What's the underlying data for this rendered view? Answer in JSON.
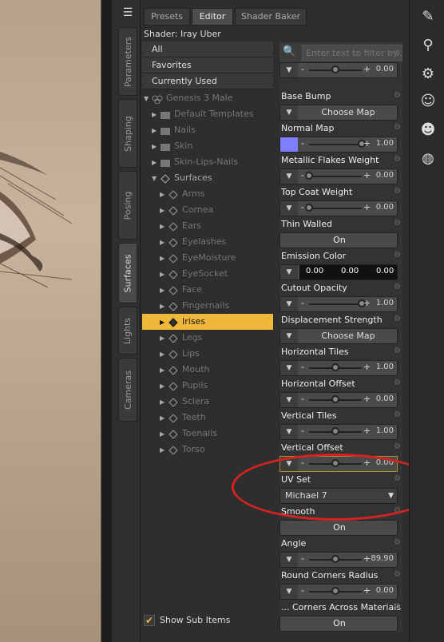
{
  "left_tabs": [
    "Parameters",
    "Shaping",
    "Posing",
    "Surfaces",
    "Lights",
    "Cameras"
  ],
  "top_tabs": [
    "Presets",
    "Editor",
    "Shader Baker"
  ],
  "shader_label": "Shader: Iray Uber",
  "categories": [
    "All",
    "Favorites",
    "Currently Used"
  ],
  "tree": {
    "root": "Genesis 3 Male",
    "folders": [
      "Default Templates",
      "Nails",
      "Skin",
      "Skin-Lips-Nails"
    ],
    "surfaces_label": "Surfaces",
    "surfaces": [
      "Arms",
      "Cornea",
      "Ears",
      "Eyelashes",
      "EyeMoisture",
      "EyeSocket",
      "Face",
      "Fingernails",
      "Irises",
      "Legs",
      "Lips",
      "Mouth",
      "Pupils",
      "Sclera",
      "Teeth",
      "Toenails",
      "Torso"
    ],
    "selected": "Irises"
  },
  "show_sub_items": "Show Sub Items",
  "filter_placeholder": "Enter text to filter by...",
  "properties": [
    {
      "label": "",
      "value": "0.00",
      "knob": 0.5
    },
    {
      "label": "Base Bump",
      "action": "Choose Map"
    },
    {
      "label": "Normal Map",
      "value": "1.00",
      "knob": 1.0,
      "swatch": "#8080ff"
    },
    {
      "label": "Metallic Flakes Weight",
      "value": "0.00",
      "knob": 0.0
    },
    {
      "label": "Top Coat Weight",
      "value": "0.00",
      "knob": 0.0
    },
    {
      "label": "Thin Walled",
      "toggle": "On"
    },
    {
      "label": "Emission Color",
      "rgb": [
        "0.00",
        "0.00",
        "0.00"
      ]
    },
    {
      "label": "Cutout Opacity",
      "value": "1.00",
      "knob": 1.0
    },
    {
      "label": "Displacement Strength",
      "action": "Choose Map"
    },
    {
      "label": "Horizontal Tiles",
      "value": "1.00",
      "knob": 0.5
    },
    {
      "label": "Horizontal Offset",
      "value": "0.00",
      "knob": 0.5
    },
    {
      "label": "Vertical Tiles",
      "value": "1.00",
      "knob": 0.5
    },
    {
      "label": "Vertical Offset",
      "value": "0.00",
      "knob": 0.5
    },
    {
      "label": "UV Set",
      "select": "Michael 7"
    },
    {
      "label": "Smooth",
      "toggle": "On"
    },
    {
      "label": "Angle",
      "value": "89.90",
      "knob": 0.5
    },
    {
      "label": "Round Corners Radius",
      "value": "0.00",
      "knob": 0.5
    },
    {
      "label": "... Corners Across Materials",
      "toggle": "On"
    }
  ],
  "colors": {
    "accent": "#f0b83a",
    "annotation": "#d42222"
  },
  "right_tools": [
    "hair-brush-icon",
    "magnifier-icon",
    "node-weight-icon",
    "head-profile-icon",
    "face-rig-icon",
    "globe-icon"
  ]
}
